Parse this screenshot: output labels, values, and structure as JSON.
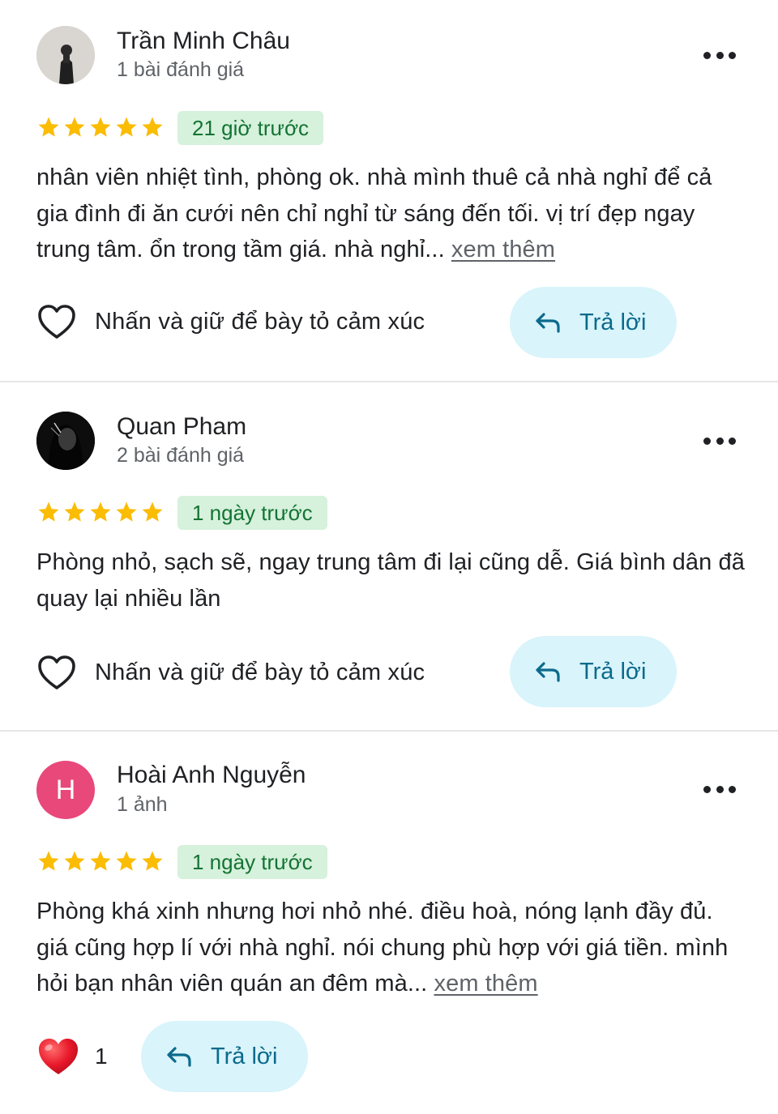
{
  "reviews": [
    {
      "author": "Trần Minh Châu",
      "subtitle": "1 bài đánh giá",
      "rating": 5,
      "time": "21 giờ trước",
      "text": "nhân viên nhiệt tình, phòng ok. nhà mình thuê cả nhà nghỉ để cả gia đình đi ăn cưới nên chỉ nghỉ từ sáng đến tối. vị trí đẹp ngay trung tâm. ổn trong tầm giá. nhà nghỉ...",
      "more_label": "xem thêm",
      "react_label": "Nhấn và giữ để bày tỏ cảm xúc",
      "reply_label": "Trả lời"
    },
    {
      "author": "Quan Pham",
      "subtitle": "2 bài đánh giá",
      "rating": 5,
      "time": "1 ngày trước",
      "text": "Phòng nhỏ, sạch sẽ, ngay trung tâm đi lại cũng dễ. Giá bình dân đã quay lại nhiều lần",
      "react_label": "Nhấn và giữ để bày tỏ cảm xúc",
      "reply_label": "Trả lời"
    },
    {
      "author": "Hoài Anh Nguyễn",
      "avatar_letter": "H",
      "subtitle": "1 ảnh",
      "rating": 5,
      "time": "1 ngày trước",
      "text": "Phòng khá xinh nhưng hơi nhỏ nhé. điều hoà, nóng lạnh đầy đủ. giá cũng hợp lí với nhà nghỉ. nói chung phù hợp với giá tiền. mình hỏi bạn nhân viên quán an đêm mà...",
      "more_label": "xem thêm",
      "like_count": "1",
      "reply_label": "Trả lời"
    }
  ],
  "colors": {
    "star": "#fbbc04",
    "badge_bg": "#d6f1dc",
    "badge_text": "#137333",
    "reply_bg": "#d9f4fb",
    "reply_text": "#0b6a8c",
    "avatar_letter_bg": "#e8487a",
    "heart_filled": "#e8182a"
  }
}
